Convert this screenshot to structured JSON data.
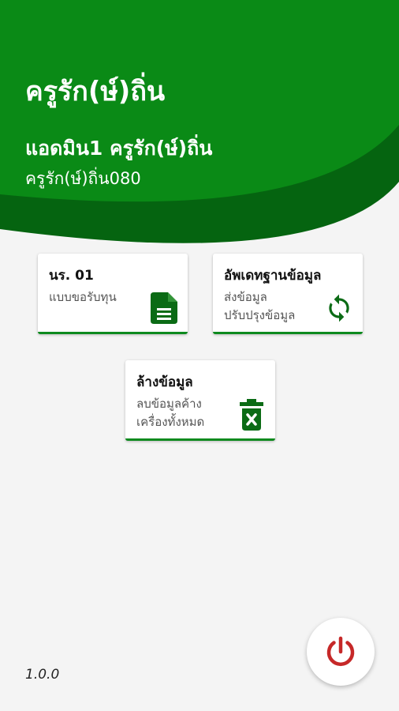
{
  "header": {
    "app_title": "ครูรัก(ษ์)ถิ่น",
    "user_name": "แอดมิน1 ครูรัก(ษ์)ถิ่น",
    "user_school": "ครูรัก(ษ์)ถิ่น080"
  },
  "cards": [
    {
      "title": "นร. 01",
      "desc_line1": "แบบขอรับทุน",
      "desc_line2": "",
      "icon": "document-icon"
    },
    {
      "title": "อัพเดทฐานข้อมูล",
      "desc_line1": "ส่งข้อมูล",
      "desc_line2": "ปรับปรุงข้อมูล",
      "icon": "sync-icon"
    },
    {
      "title": "ล้างข้อมูล",
      "desc_line1": "ลบข้อมูลค้าง",
      "desc_line2": "เครื่องทั้งหมด",
      "icon": "delete-icon"
    }
  ],
  "footer": {
    "version": "1.0.0",
    "power_icon": "power-icon"
  },
  "colors": {
    "primary_green": "#0a8a16",
    "dark_green": "#056410",
    "accent_red": "#c62828",
    "background": "#f4f4f4"
  }
}
